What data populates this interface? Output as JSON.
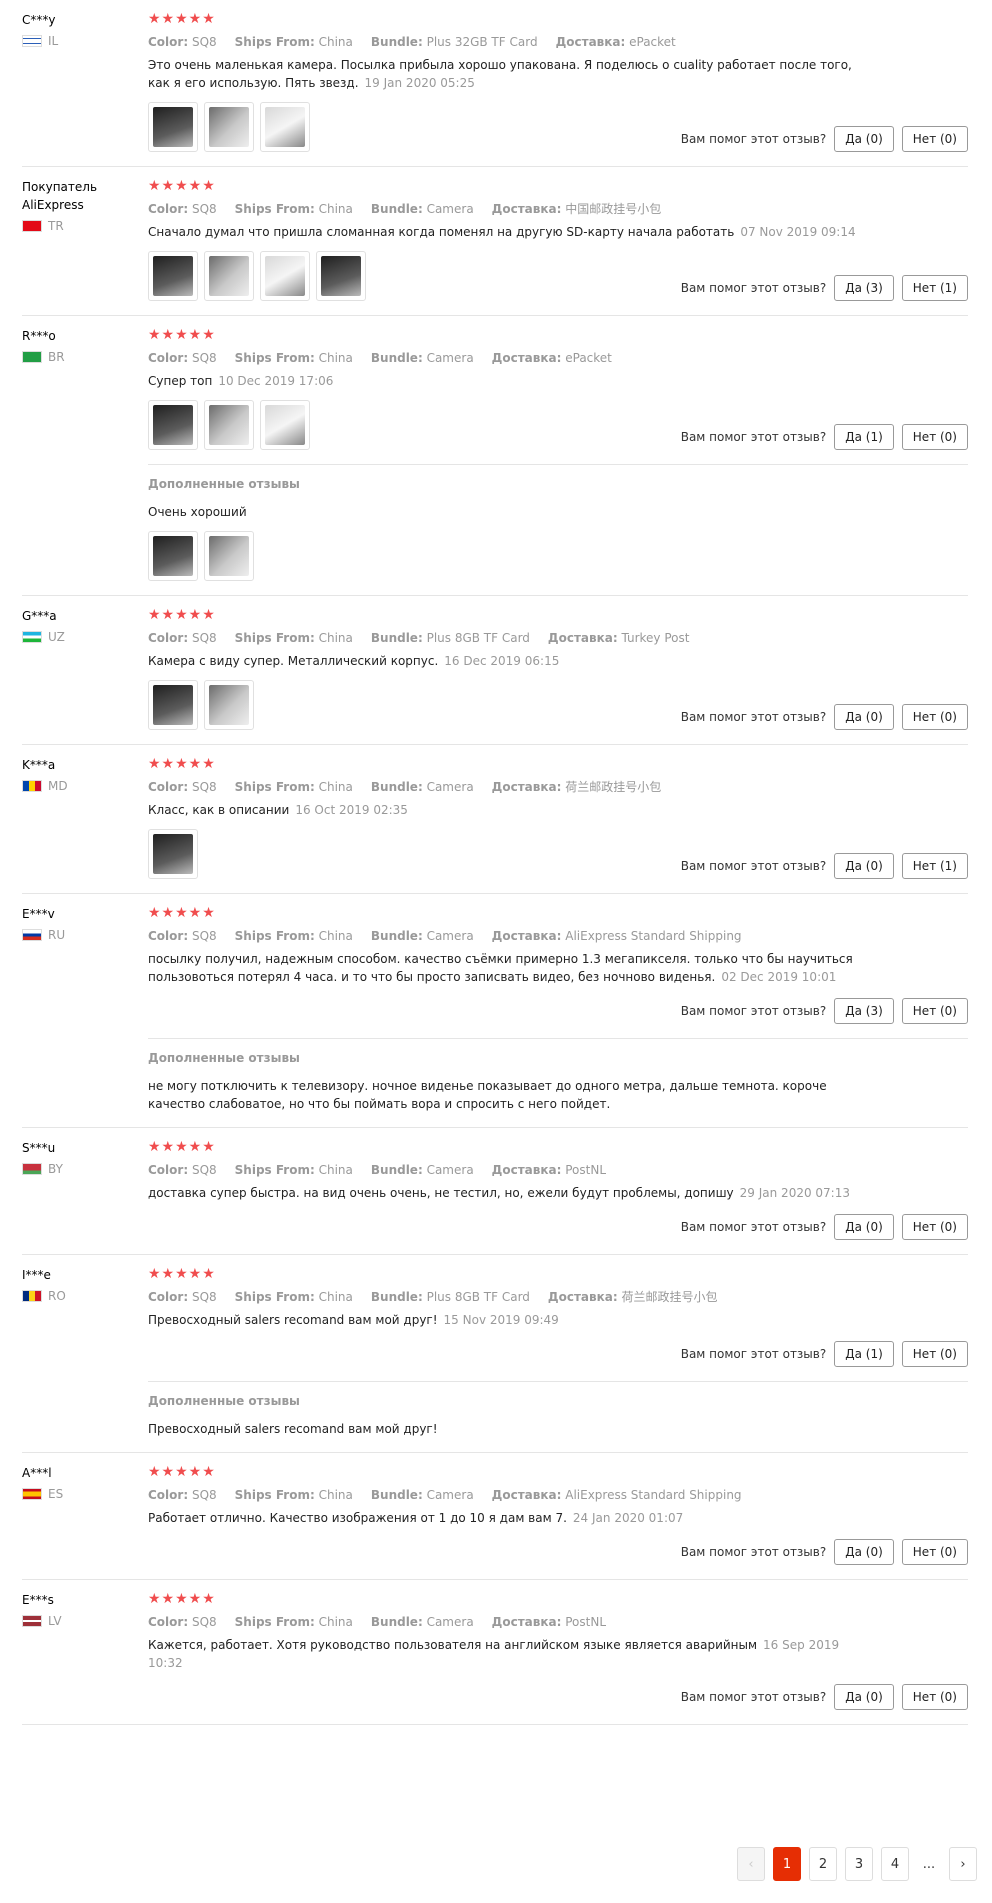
{
  "labels": {
    "color": "Color:",
    "ships_from": "Ships From:",
    "bundle": "Bundle:",
    "delivery": "Доставка:",
    "helpful": "Вам помог этот отзыв?",
    "additional": "Дополненные отзывы",
    "stars": "★★★★★"
  },
  "reviews": [
    {
      "name": "C***y",
      "country": "IL",
      "color": "SQ8",
      "ships_from": "China",
      "bundle": "Plus 32GB TF Card",
      "delivery": "ePacket",
      "text": "Это очень маленькая камера. Посылка прибыла хорошо упакована. Я поделюсь о cuality работает после того, как я его использую. Пять звезд.",
      "date": "19 Jan 2020 05:25",
      "yes": "Да (0)",
      "no": "Нет (0)",
      "photos": 3
    },
    {
      "name": "Покупатель AliExpress",
      "country": "TR",
      "color": "SQ8",
      "ships_from": "China",
      "bundle": "Camera",
      "delivery": "中国邮政挂号小包",
      "text": "Сначало думал что пришла сломанная когда поменял на другую SD-карту начала работать",
      "date": "07 Nov 2019 09:14",
      "yes": "Да (3)",
      "no": "Нет (1)",
      "photos": 4
    },
    {
      "name": "R***o",
      "country": "BR",
      "color": "SQ8",
      "ships_from": "China",
      "bundle": "Camera",
      "delivery": "ePacket",
      "text": "Супер топ",
      "date": "10 Dec 2019 17:06",
      "yes": "Да (1)",
      "no": "Нет (0)",
      "photos": 3,
      "additional": {
        "text": "Очень хороший",
        "photos": 2
      }
    },
    {
      "name": "G***a",
      "country": "UZ",
      "color": "SQ8",
      "ships_from": "China",
      "bundle": "Plus 8GB TF Card",
      "delivery": "Turkey Post",
      "text": "Камера с виду супер. Металлический корпус.",
      "date": "16 Dec 2019 06:15",
      "yes": "Да (0)",
      "no": "Нет (0)",
      "photos": 2
    },
    {
      "name": "K***a",
      "country": "MD",
      "color": "SQ8",
      "ships_from": "China",
      "bundle": "Camera",
      "delivery": "荷兰邮政挂号小包",
      "text": "Класс, как в описании",
      "date": "16 Oct 2019 02:35",
      "yes": "Да (0)",
      "no": "Нет (1)",
      "photos": 1
    },
    {
      "name": "E***v",
      "country": "RU",
      "color": "SQ8",
      "ships_from": "China",
      "bundle": "Camera",
      "delivery": "AliExpress Standard Shipping",
      "text": "посылку получил, надежным способом. качество съёмки примерно 1.3 мегапикселя. только что бы научиться пользовоться потерял 4 часа. и то что бы просто записвать видео, без ночново виденья.",
      "date": "02 Dec 2019 10:01",
      "yes": "Да (3)",
      "no": "Нет (0)",
      "photos": 0,
      "additional": {
        "text": "не могу потключить к телевизору. ночное виденье показывает до одного метра, дальше темнота. короче качество слабоватое, но что бы поймать вора и спросить с него пойдет.",
        "photos": 0
      }
    },
    {
      "name": "S***u",
      "country": "BY",
      "color": "SQ8",
      "ships_from": "China",
      "bundle": "Camera",
      "delivery": "PostNL",
      "text": "доставка супер быстра. на вид очень очень, не тестил, но, ежели будут проблемы, допишу",
      "date": "29 Jan 2020 07:13",
      "yes": "Да (0)",
      "no": "Нет (0)",
      "photos": 0
    },
    {
      "name": "I***e",
      "country": "RO",
      "color": "SQ8",
      "ships_from": "China",
      "bundle": "Plus 8GB TF Card",
      "delivery": "荷兰邮政挂号小包",
      "text": "Превосходный salers recomand вам мой друг!",
      "date": "15 Nov 2019 09:49",
      "yes": "Да (1)",
      "no": "Нет (0)",
      "photos": 0,
      "additional": {
        "text": "Превосходный salers recomand вам мой друг!",
        "photos": 0
      }
    },
    {
      "name": "A***l",
      "country": "ES",
      "color": "SQ8",
      "ships_from": "China",
      "bundle": "Camera",
      "delivery": "AliExpress Standard Shipping",
      "text": "Работает отлично. Качество изображения от 1 до 10 я дам вам 7.",
      "date": "24 Jan 2020 01:07",
      "yes": "Да (0)",
      "no": "Нет (0)",
      "photos": 0
    },
    {
      "name": "E***s",
      "country": "LV",
      "color": "SQ8",
      "ships_from": "China",
      "bundle": "Camera",
      "delivery": "PostNL",
      "text": "Кажется, работает. Хотя руководство пользователя на английском языке является аварийным",
      "date": "16 Sep 2019 10:32",
      "yes": "Да (0)",
      "no": "Нет (0)",
      "photos": 0
    }
  ],
  "pagination": {
    "prev": "‹",
    "pages": [
      "1",
      "2",
      "3",
      "4"
    ],
    "active": "1",
    "dots": "...",
    "next": "›"
  }
}
